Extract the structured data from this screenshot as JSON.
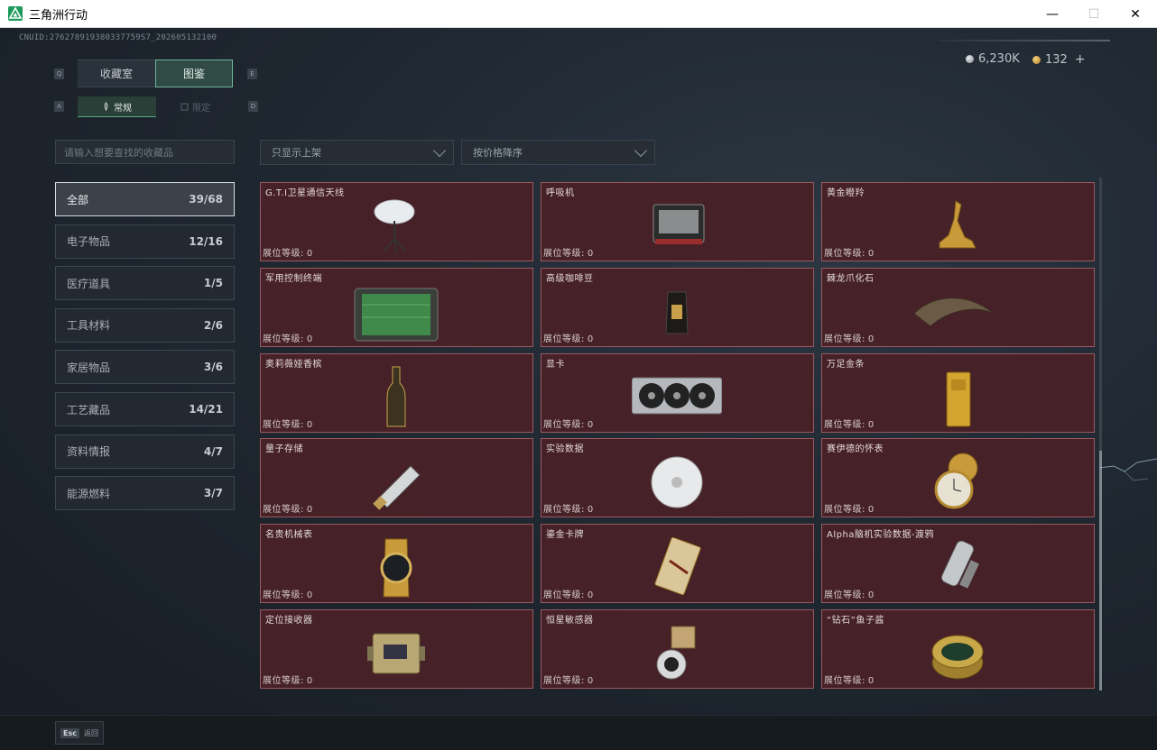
{
  "window": {
    "title": "三角洲行动",
    "minimize": "—",
    "maximize": "☐",
    "close": "✕"
  },
  "header": {
    "uid": "CNUID:276278919380337759S7_202605132100",
    "currency": [
      {
        "value": "6,230K",
        "icon": "silver-coin-icon"
      },
      {
        "value": "132",
        "icon": "gold-coin-icon",
        "plus": "+"
      }
    ]
  },
  "tabs": {
    "main": [
      {
        "label": "收藏室"
      },
      {
        "label": "图鉴",
        "active": true
      }
    ],
    "sub": [
      {
        "label": "常规",
        "active": true
      },
      {
        "label": "限定"
      }
    ],
    "keys": {
      "q": "Q",
      "e": "E",
      "a": "A",
      "d": "D"
    }
  },
  "search": {
    "placeholder": "请输入想要查找的收藏品"
  },
  "filters": {
    "shelf": "只显示上架",
    "sort": "按价格降序"
  },
  "categories": [
    {
      "label": "全部",
      "count": "39/68",
      "active": true
    },
    {
      "label": "电子物品",
      "count": "12/16"
    },
    {
      "label": "医疗道具",
      "count": "1/5"
    },
    {
      "label": "工具材料",
      "count": "2/6"
    },
    {
      "label": "家居物品",
      "count": "3/6"
    },
    {
      "label": "工艺藏品",
      "count": "14/21"
    },
    {
      "label": "资料情报",
      "count": "4/7"
    },
    {
      "label": "能源燃料",
      "count": "3/7"
    }
  ],
  "level_label": "展位等级:",
  "items": [
    {
      "name": "G.T.I卫星通信天线",
      "level": "0",
      "icon": "satellite-dish-icon"
    },
    {
      "name": "呼吸机",
      "level": "0",
      "icon": "ventilator-icon"
    },
    {
      "name": "黄金瞪羚",
      "level": "0",
      "icon": "golden-gazelle-icon"
    },
    {
      "name": "军用控制终端",
      "level": "0",
      "icon": "control-terminal-icon"
    },
    {
      "name": "高级咖啡豆",
      "level": "0",
      "icon": "coffee-bag-icon"
    },
    {
      "name": "棘龙爪化石",
      "level": "0",
      "icon": "claw-fossil-icon"
    },
    {
      "name": "奥莉薇娅香槟",
      "level": "0",
      "icon": "champagne-icon"
    },
    {
      "name": "显卡",
      "level": "0",
      "icon": "graphics-card-icon"
    },
    {
      "name": "万足金条",
      "level": "0",
      "icon": "gold-bar-icon"
    },
    {
      "name": "量子存储",
      "level": "0",
      "icon": "usb-drive-icon"
    },
    {
      "name": "实验数据",
      "level": "0",
      "icon": "disc-icon"
    },
    {
      "name": "赛伊德的怀表",
      "level": "0",
      "icon": "pocket-watch-icon"
    },
    {
      "name": "名贵机械表",
      "level": "0",
      "icon": "wristwatch-icon"
    },
    {
      "name": "鎏金卡牌",
      "level": "0",
      "icon": "gilded-card-icon"
    },
    {
      "name": "Alpha脑机实验数据-渡鸦",
      "level": "0",
      "icon": "data-canister-icon"
    },
    {
      "name": "定位接收器",
      "level": "0",
      "icon": "receiver-module-icon"
    },
    {
      "name": "恒星敏感器",
      "level": "0",
      "icon": "star-sensor-icon"
    },
    {
      "name": "“钻石”鱼子酱",
      "level": "0",
      "icon": "caviar-tin-icon"
    }
  ],
  "footer": {
    "esc_key": "Esc",
    "esc_label": "返回"
  }
}
